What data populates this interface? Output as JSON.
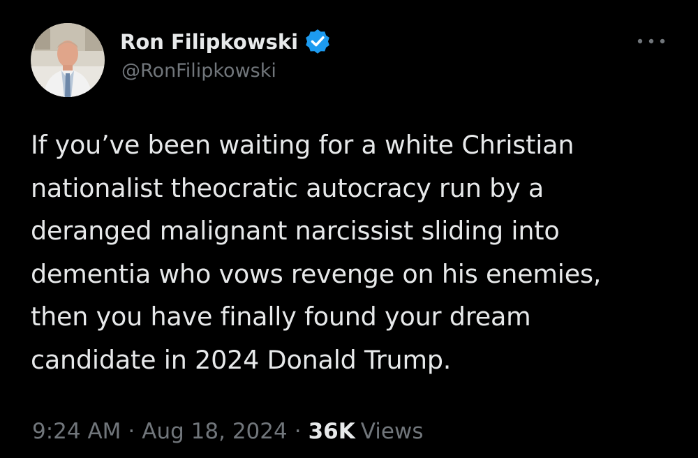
{
  "author": {
    "display_name": "Ron Filipkowski",
    "handle": "@RonFilipkowski",
    "verified": true,
    "verified_color": "#1d9bf0"
  },
  "tweet": {
    "text_lines": [
      "If you’ve been waiting for a white Christian",
      "nationalist theocratic autocracy run by a",
      "deranged malignant narcissist sliding into",
      "dementia who vows revenge on his enemies,",
      "then you have finally found your dream",
      "candidate in 2024 Donald Trump."
    ],
    "time": "9:24 AM",
    "separator": "·",
    "date": "Aug 18, 2024",
    "views_count": "36K",
    "views_label": "Views"
  },
  "icons": {
    "verified": "verified-badge-icon",
    "more": "more-options-icon"
  },
  "colors": {
    "background": "#000000",
    "text_primary": "#e7e9ea",
    "text_secondary": "#71767b"
  }
}
